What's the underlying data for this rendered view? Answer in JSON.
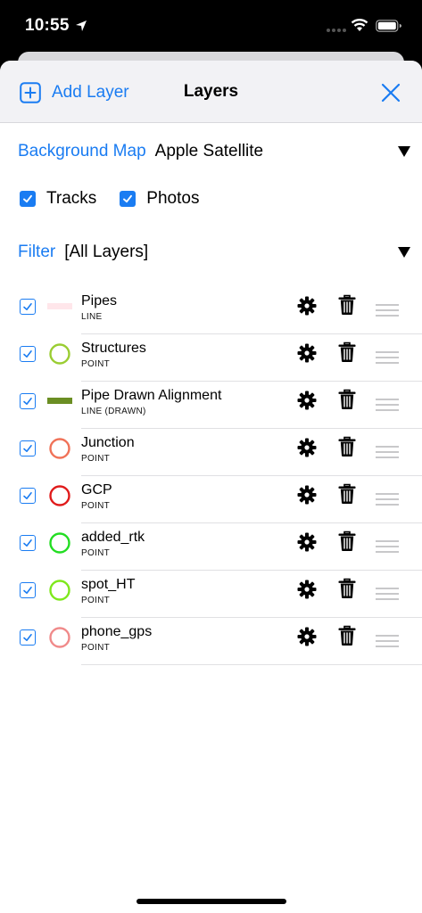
{
  "status_bar": {
    "time": "10:55"
  },
  "header": {
    "add_layer_label": "Add Layer",
    "title": "Layers"
  },
  "background_map": {
    "label": "Background Map",
    "value": "Apple Satellite"
  },
  "toggles": {
    "tracks_label": "Tracks",
    "tracks_checked": true,
    "photos_label": "Photos",
    "photos_checked": true
  },
  "filter": {
    "label": "Filter",
    "value": "[All Layers]"
  },
  "layers": [
    {
      "name": "Pipes",
      "type": "LINE",
      "symbol": "line",
      "color": "#ffe6ea",
      "checked": true
    },
    {
      "name": "Structures",
      "type": "POINT",
      "symbol": "circle",
      "color": "#9acd32",
      "checked": true
    },
    {
      "name": "Pipe Drawn Alignment",
      "type": "LINE (DRAWN)",
      "symbol": "line",
      "color": "#6b8e23",
      "checked": true
    },
    {
      "name": "Junction",
      "type": "POINT",
      "symbol": "circle",
      "color": "#f07258",
      "checked": true
    },
    {
      "name": "GCP",
      "type": "POINT",
      "symbol": "circle",
      "color": "#e01b1b",
      "checked": true
    },
    {
      "name": "added_rtk",
      "type": "POINT",
      "symbol": "circle",
      "color": "#22dd22",
      "checked": true
    },
    {
      "name": "spot_HT",
      "type": "POINT",
      "symbol": "circle",
      "color": "#7ee81c",
      "checked": true
    },
    {
      "name": "phone_gps",
      "type": "POINT",
      "symbol": "circle",
      "color": "#f08a8a",
      "checked": true
    }
  ],
  "colors": {
    "accent": "#1a7cf2",
    "header_bg": "#f2f2f5"
  }
}
